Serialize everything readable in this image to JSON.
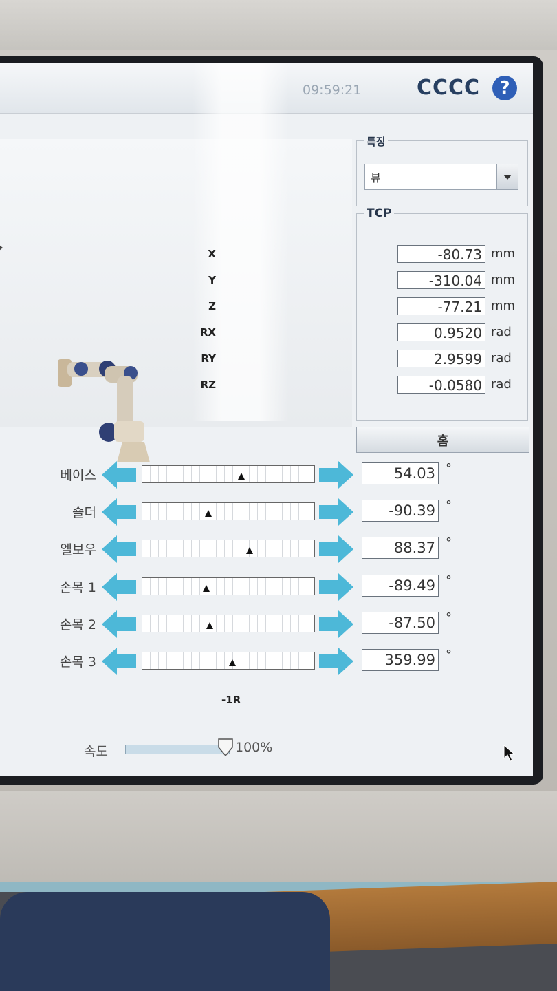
{
  "header": {
    "clock": "09:59:21",
    "robot_name": "CCCC",
    "help_icon": "question-mark-icon"
  },
  "feature": {
    "title": "특징",
    "selected": "뷰"
  },
  "tcp": {
    "title": "TCP",
    "rows": [
      {
        "label": "X",
        "value": "-80.73",
        "unit": "mm"
      },
      {
        "label": "Y",
        "value": "-310.04",
        "unit": "mm"
      },
      {
        "label": "Z",
        "value": "-77.21",
        "unit": "mm"
      },
      {
        "label": "RX",
        "value": "0.9520",
        "unit": "rad"
      },
      {
        "label": "RY",
        "value": "2.9599",
        "unit": "rad"
      },
      {
        "label": "RZ",
        "value": "-0.0580",
        "unit": "rad"
      }
    ]
  },
  "move_button": {
    "label": "홈"
  },
  "joints": [
    {
      "label": "베이스",
      "value": "54.03",
      "unit": "°",
      "position": 0.57
    },
    {
      "label": "숄더",
      "value": "-90.39",
      "unit": "°",
      "position": 0.38
    },
    {
      "label": "엘보우",
      "value": "88.37",
      "unit": "°",
      "position": 0.62
    },
    {
      "label": "손목 1",
      "value": "-89.49",
      "unit": "°",
      "position": 0.37
    },
    {
      "label": "손목 2",
      "value": "-87.50",
      "unit": "°",
      "position": 0.39
    },
    {
      "label": "손목 3",
      "value": "359.99",
      "unit": "°",
      "position": 0.52
    }
  ],
  "range_label": "-1R",
  "speed": {
    "label": "속도",
    "value": "100%",
    "fraction": 1.0
  },
  "colors": {
    "arrow": "#4db8d8",
    "title_blue": "#273f61",
    "help_blue": "#2f5fb7"
  }
}
